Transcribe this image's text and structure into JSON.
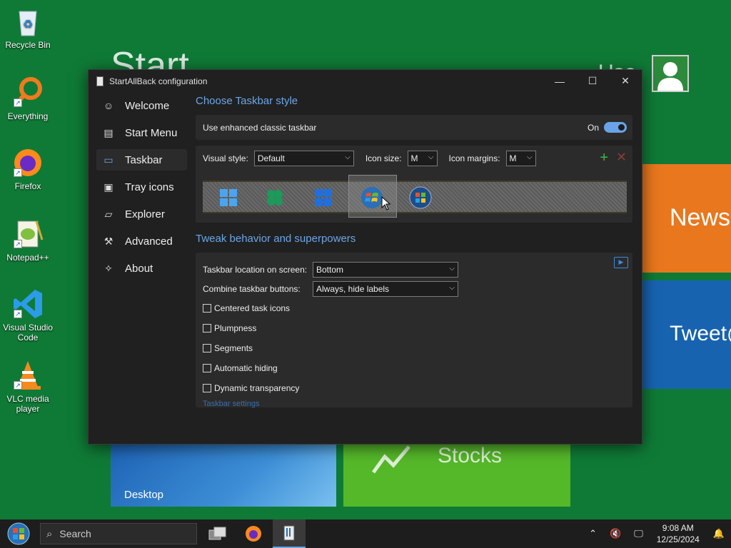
{
  "background": {
    "start_text": "Start",
    "user_text": "Use",
    "tiles": {
      "news": "News",
      "tweet": "Tweet@",
      "desktop": "Desktop",
      "stocks": "Stocks"
    }
  },
  "desktop_icons": [
    {
      "label": "Recycle Bin",
      "icon": "recycle-bin-icon"
    },
    {
      "label": "Everything",
      "icon": "everything-search-icon"
    },
    {
      "label": "Firefox",
      "icon": "firefox-icon"
    },
    {
      "label": "Notepad++",
      "icon": "notepad-plus-plus-icon"
    },
    {
      "label": "Visual Studio Code",
      "icon": "vscode-icon"
    },
    {
      "label": "VLC media player",
      "icon": "vlc-icon"
    }
  ],
  "window": {
    "title": "StartAllBack configuration",
    "sidebar": [
      {
        "label": "Welcome",
        "icon": "smiley-icon",
        "glyph": "☺"
      },
      {
        "label": "Start Menu",
        "icon": "start-menu-icon",
        "glyph": "▤"
      },
      {
        "label": "Taskbar",
        "icon": "taskbar-icon",
        "glyph": "▭",
        "active": true
      },
      {
        "label": "Tray icons",
        "icon": "tray-icons-icon",
        "glyph": "▣"
      },
      {
        "label": "Explorer",
        "icon": "folder-icon",
        "glyph": "▱"
      },
      {
        "label": "Advanced",
        "icon": "wrench-icon",
        "glyph": "⚒"
      },
      {
        "label": "About",
        "icon": "about-icon",
        "glyph": "✧"
      }
    ],
    "taskbar_style": {
      "title": "Choose Taskbar style",
      "enhanced_label": "Use enhanced classic taskbar",
      "enhanced_state": "On",
      "visual_style_label": "Visual style:",
      "visual_style_value": "Default",
      "icon_size_label": "Icon size:",
      "icon_size_value": "M",
      "icon_margins_label": "Icon margins:",
      "icon_margins_value": "M",
      "presets": [
        "windows-10-logo-icon",
        "windows-11-clover-icon",
        "windows-11-logo-icon",
        "windows-7-orb-icon",
        "windows-vista-orb-icon"
      ],
      "selected_preset": 3
    },
    "tweak": {
      "title": "Tweak behavior and superpowers",
      "location_label": "Taskbar location on screen:",
      "location_value": "Bottom",
      "combine_label": "Combine taskbar buttons:",
      "combine_value": "Always, hide labels",
      "checkboxes": [
        {
          "label": "Centered task icons",
          "checked": false
        },
        {
          "label": "Plumpness",
          "checked": false
        },
        {
          "label": "Segments",
          "checked": false
        },
        {
          "label": "Automatic hiding",
          "checked": false
        },
        {
          "label": "Dynamic transparency",
          "checked": false
        }
      ],
      "settings_link": "Taskbar settings"
    }
  },
  "taskbar": {
    "search_placeholder": "Search",
    "time": "9:08 AM",
    "date": "12/25/2024"
  },
  "colors": {
    "desktop_bg": "#0f7a36",
    "accent": "#6ca6e6",
    "window_bg": "#202020"
  }
}
